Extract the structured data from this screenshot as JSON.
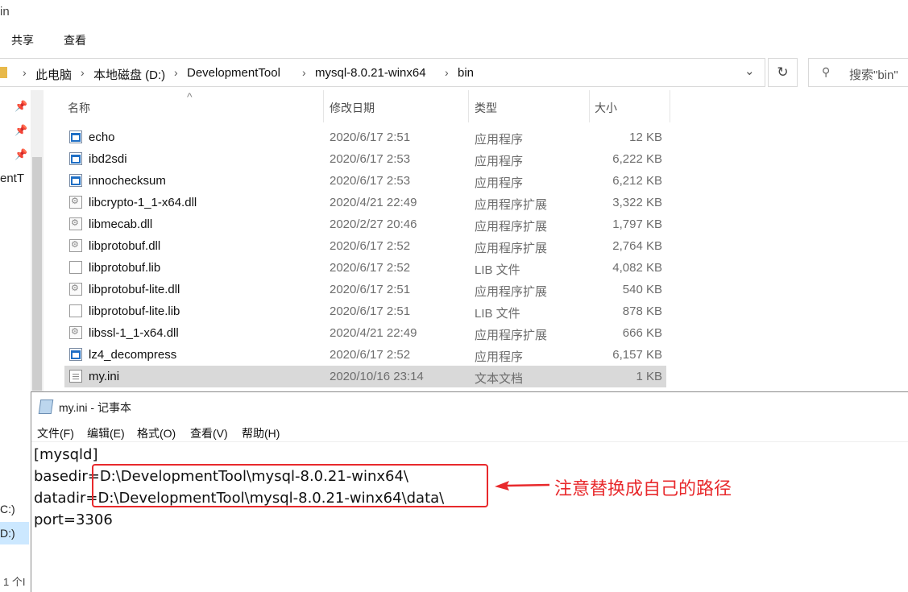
{
  "window": {
    "title_fragment": "in"
  },
  "ribbon": {
    "tabs": [
      "共享",
      "查看"
    ]
  },
  "address": {
    "crumbs": [
      "此电脑",
      "本地磁盘 (D:)",
      "DevelopmentTool",
      "mysql-8.0.21-winx64",
      "bin"
    ],
    "search_placeholder": "搜索\"bin\""
  },
  "columns": {
    "name": "名称",
    "date": "修改日期",
    "type": "类型",
    "size": "大小"
  },
  "files": [
    {
      "name": "echo",
      "date": "2020/6/17 2:51",
      "type": "应用程序",
      "size": "12 KB",
      "icon": "exe"
    },
    {
      "name": "ibd2sdi",
      "date": "2020/6/17 2:53",
      "type": "应用程序",
      "size": "6,222 KB",
      "icon": "exe"
    },
    {
      "name": "innochecksum",
      "date": "2020/6/17 2:53",
      "type": "应用程序",
      "size": "6,212 KB",
      "icon": "exe"
    },
    {
      "name": "libcrypto-1_1-x64.dll",
      "date": "2020/4/21 22:49",
      "type": "应用程序扩展",
      "size": "3,322 KB",
      "icon": "dll"
    },
    {
      "name": "libmecab.dll",
      "date": "2020/2/27 20:46",
      "type": "应用程序扩展",
      "size": "1,797 KB",
      "icon": "dll"
    },
    {
      "name": "libprotobuf.dll",
      "date": "2020/6/17 2:52",
      "type": "应用程序扩展",
      "size": "2,764 KB",
      "icon": "dll"
    },
    {
      "name": "libprotobuf.lib",
      "date": "2020/6/17 2:52",
      "type": "LIB 文件",
      "size": "4,082 KB",
      "icon": "lib"
    },
    {
      "name": "libprotobuf-lite.dll",
      "date": "2020/6/17 2:51",
      "type": "应用程序扩展",
      "size": "540 KB",
      "icon": "dll"
    },
    {
      "name": "libprotobuf-lite.lib",
      "date": "2020/6/17 2:51",
      "type": "LIB 文件",
      "size": "878 KB",
      "icon": "lib"
    },
    {
      "name": "libssl-1_1-x64.dll",
      "date": "2020/4/21 22:49",
      "type": "应用程序扩展",
      "size": "666 KB",
      "icon": "dll"
    },
    {
      "name": "lz4_decompress",
      "date": "2020/6/17 2:52",
      "type": "应用程序",
      "size": "6,157 KB",
      "icon": "exe"
    },
    {
      "name": "my.ini",
      "date": "2020/10/16 23:14",
      "type": "文本文档",
      "size": "1 KB",
      "icon": "txt",
      "selected": true
    }
  ],
  "nav_fragments": [
    "entT",
    "C:)",
    "D:)",
    "1 个I"
  ],
  "notepad": {
    "title": "my.ini - 记事本",
    "menu": [
      "文件(F)",
      "编辑(E)",
      "格式(O)",
      "查看(V)",
      "帮助(H)"
    ],
    "lines": [
      "[mysqld]",
      "basedir=D:\\DevelopmentTool\\mysql-8.0.21-winx64\\",
      "datadir=D:\\DevelopmentTool\\mysql-8.0.21-winx64\\data\\",
      "port=3306"
    ]
  },
  "annotation": {
    "text": "注意替换成自己的路径",
    "color": "#e8292c"
  }
}
